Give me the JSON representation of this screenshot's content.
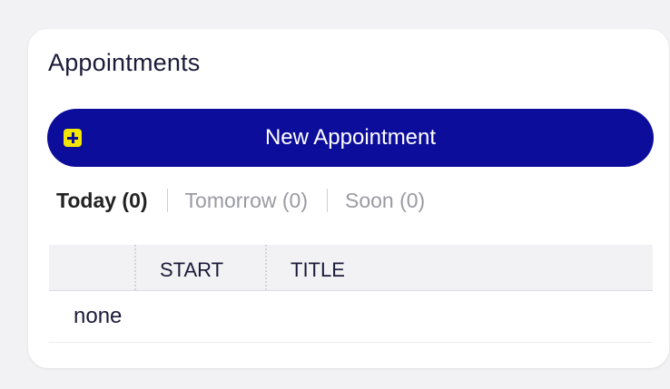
{
  "widget": {
    "title": "Appointments",
    "new_button": {
      "label": "New Appointment",
      "icon": "plus-square-icon",
      "icon_color": "#f2e600"
    },
    "filters": [
      {
        "label": "Today (0)",
        "active": true
      },
      {
        "label": "Tomorrow (0)",
        "active": false
      },
      {
        "label": "Soon (0)",
        "active": false
      }
    ],
    "table": {
      "columns": [
        "",
        "START",
        "TITLE"
      ],
      "empty_text": "none"
    }
  },
  "colors": {
    "accent": "#0d0d9c",
    "page_bg": "#f2f2f4",
    "card_bg": "#ffffff",
    "text": "#1b1b3a",
    "muted_text": "#9a9aa3"
  }
}
